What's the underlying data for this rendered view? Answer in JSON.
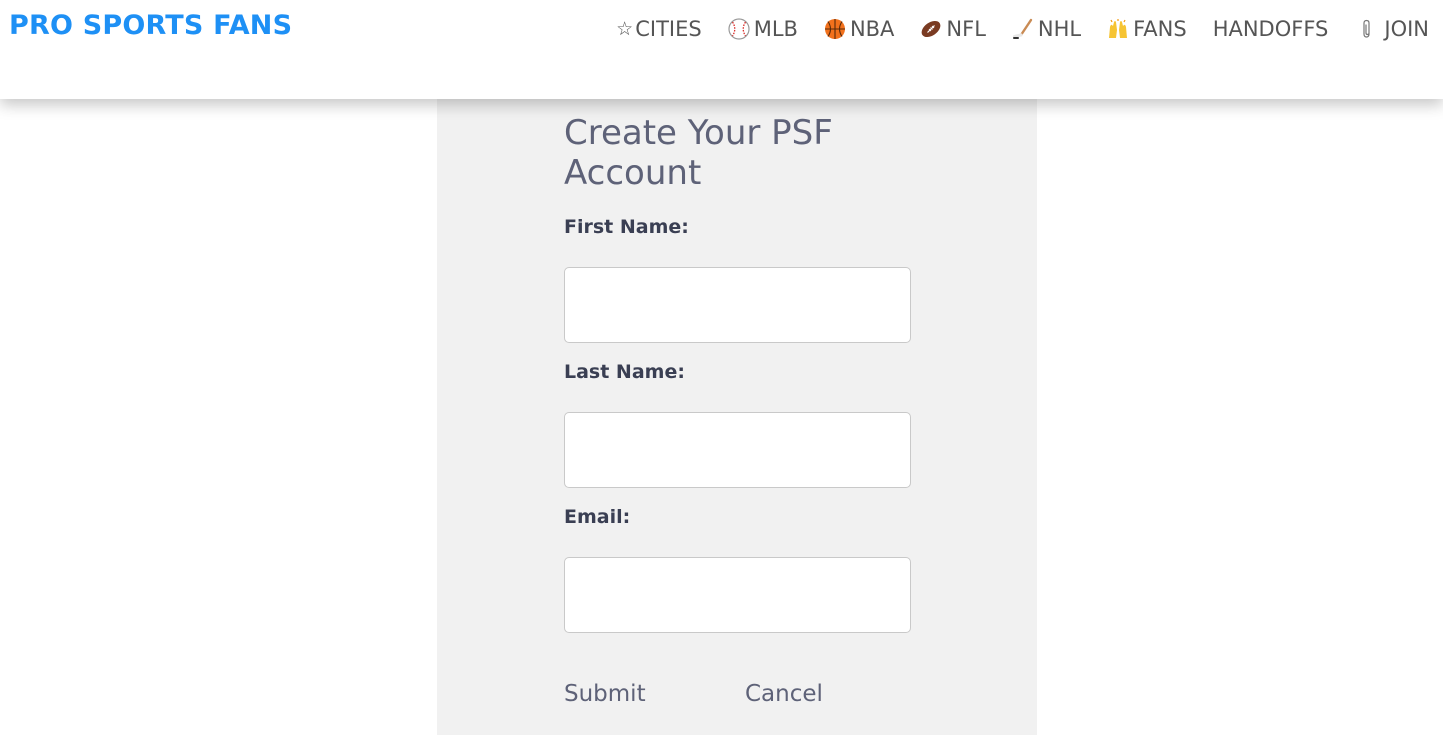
{
  "header": {
    "brand": "PRO SPORTS FANS",
    "nav": [
      {
        "label": "CITIES",
        "icon": "star-icon"
      },
      {
        "label": "MLB",
        "icon": "baseball-icon"
      },
      {
        "label": "NBA",
        "icon": "basketball-icon"
      },
      {
        "label": "NFL",
        "icon": "football-icon"
      },
      {
        "label": "NHL",
        "icon": "hockey-stick-icon"
      },
      {
        "label": "FANS",
        "icon": "raised-hands-icon"
      },
      {
        "label": "HANDOFFS",
        "icon": ""
      },
      {
        "label": "JOIN",
        "icon": "paperclip-icon"
      }
    ],
    "star_glyph": "☆"
  },
  "form": {
    "title": "Create Your PSF Account",
    "first_name_label": "First Name:",
    "first_name_value": "",
    "last_name_label": "Last Name:",
    "last_name_value": "",
    "email_label": "Email:",
    "email_value": "",
    "submit_label": "Submit",
    "cancel_label": "Cancel"
  },
  "colors": {
    "brand": "#1e90f5",
    "nav_text": "#555555",
    "panel_bg": "#f1f1f1",
    "title_text": "#5e6278",
    "label_text": "#3a3f53"
  }
}
